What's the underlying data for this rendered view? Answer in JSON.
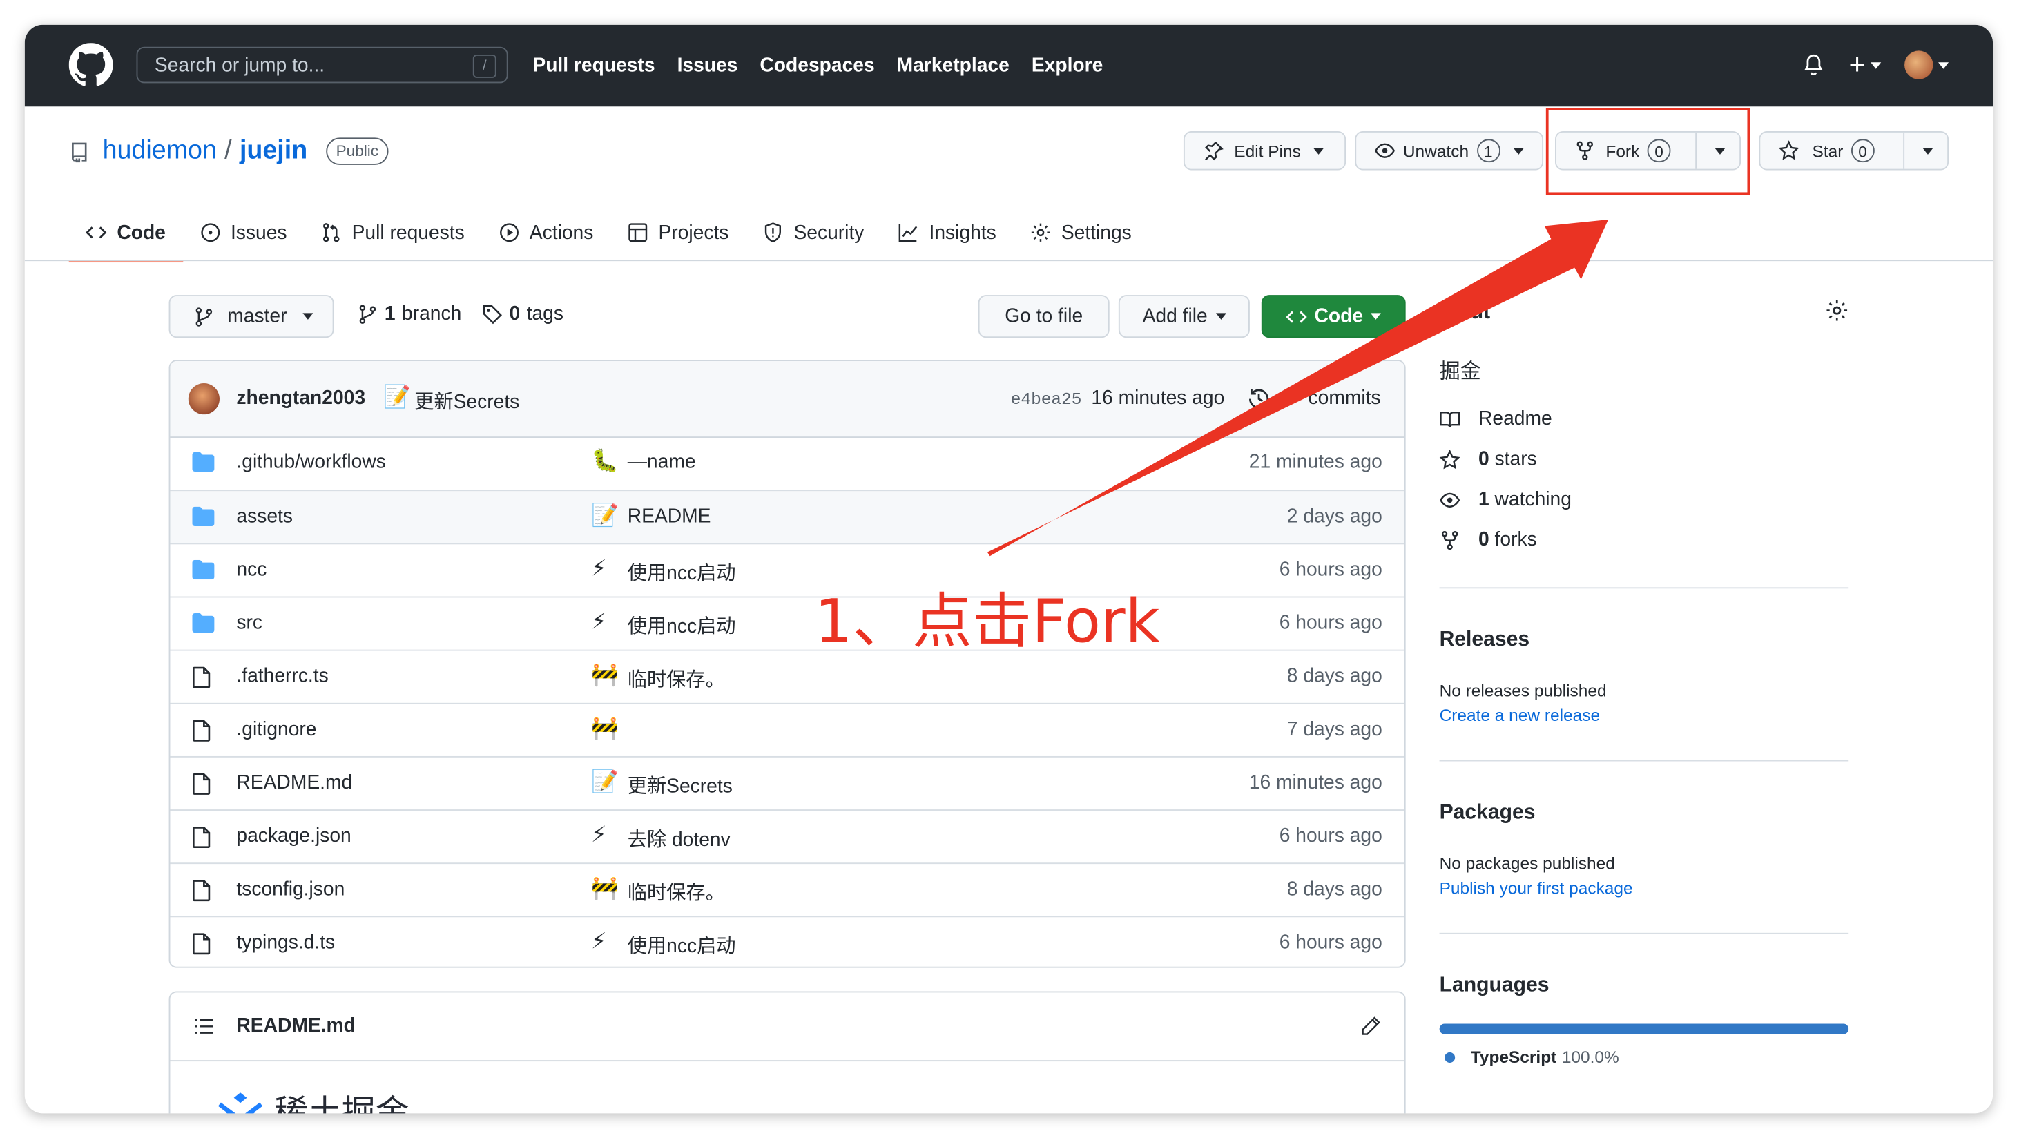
{
  "header": {
    "search_placeholder": "Search or jump to...",
    "search_shortcut": "/",
    "nav": [
      "Pull requests",
      "Issues",
      "Codespaces",
      "Marketplace",
      "Explore"
    ]
  },
  "repo": {
    "owner": "hudiemon",
    "separator": "/",
    "name": "juejin",
    "visibility": "Public",
    "edit_pins_label": "Edit Pins",
    "unwatch_label": "Unwatch",
    "unwatch_count": "1",
    "fork_label": "Fork",
    "fork_count": "0",
    "star_label": "Star",
    "star_count": "0"
  },
  "tabs": [
    {
      "label": "Code",
      "icon": "code-icon",
      "active": true
    },
    {
      "label": "Issues",
      "icon": "issue-icon"
    },
    {
      "label": "Pull requests",
      "icon": "pull-request-icon"
    },
    {
      "label": "Actions",
      "icon": "play-icon"
    },
    {
      "label": "Projects",
      "icon": "table-icon"
    },
    {
      "label": "Security",
      "icon": "shield-icon"
    },
    {
      "label": "Insights",
      "icon": "graph-icon"
    },
    {
      "label": "Settings",
      "icon": "gear-icon"
    }
  ],
  "filenav": {
    "branch": "master",
    "branch_count": "1",
    "branch_word": "branch",
    "tag_count": "0",
    "tag_word": "tags",
    "go_to_file": "Go to file",
    "add_file": "Add file",
    "code": "Code"
  },
  "latest_commit": {
    "author": "zhengtan2003",
    "emoji": "📝",
    "message": "更新Secrets",
    "sha": "e4bea25",
    "time": "16 minutes ago",
    "commits_label": "commits"
  },
  "files": [
    {
      "type": "dir",
      "name": ".github/workflows",
      "emoji": "🐛",
      "message": "—name",
      "age": "21 minutes ago"
    },
    {
      "type": "dir",
      "name": "assets",
      "emoji": "📝",
      "message": "README",
      "age": "2 days ago"
    },
    {
      "type": "dir",
      "name": "ncc",
      "emoji": "⚡",
      "message": "使用ncc启动",
      "age": "6 hours ago"
    },
    {
      "type": "dir",
      "name": "src",
      "emoji": "⚡",
      "message": "使用ncc启动",
      "age": "6 hours ago"
    },
    {
      "type": "file",
      "name": ".fatherrc.ts",
      "emoji": "🚧",
      "message": "临时保存。",
      "age": "8 days ago"
    },
    {
      "type": "file",
      "name": ".gitignore",
      "emoji": "🚧",
      "message": "",
      "age": "7 days ago"
    },
    {
      "type": "file",
      "name": "README.md",
      "emoji": "📝",
      "message": "更新Secrets",
      "age": "16 minutes ago"
    },
    {
      "type": "file",
      "name": "package.json",
      "emoji": "⚡",
      "message": "去除 dotenv",
      "age": "6 hours ago"
    },
    {
      "type": "file",
      "name": "tsconfig.json",
      "emoji": "🚧",
      "message": "临时保存。",
      "age": "8 days ago"
    },
    {
      "type": "file",
      "name": "typings.d.ts",
      "emoji": "⚡",
      "message": "使用ncc启动",
      "age": "6 hours ago"
    }
  ],
  "readme": {
    "title": "README.md",
    "logo_text": "稀土掘金"
  },
  "about": {
    "heading": "ut",
    "description": "掘金",
    "items": [
      {
        "icon": "book-icon",
        "count": "",
        "label": "Readme"
      },
      {
        "icon": "star-icon",
        "count": "0",
        "label": "stars"
      },
      {
        "icon": "eye-icon",
        "count": "1",
        "label": "watching"
      },
      {
        "icon": "fork-icon",
        "count": "0",
        "label": "forks"
      }
    ]
  },
  "releases": {
    "heading": "Releases",
    "empty": "No releases published",
    "link": "Create a new release"
  },
  "packages": {
    "heading": "Packages",
    "empty": "No packages published",
    "link": "Publish your first package"
  },
  "languages": {
    "heading": "Languages",
    "items": [
      {
        "name": "TypeScript",
        "percent": "100.0%",
        "fraction": 1.0,
        "color": "#3178c6"
      }
    ]
  },
  "annotation": {
    "text": "1、点击Fork",
    "color": "#ea3323"
  }
}
